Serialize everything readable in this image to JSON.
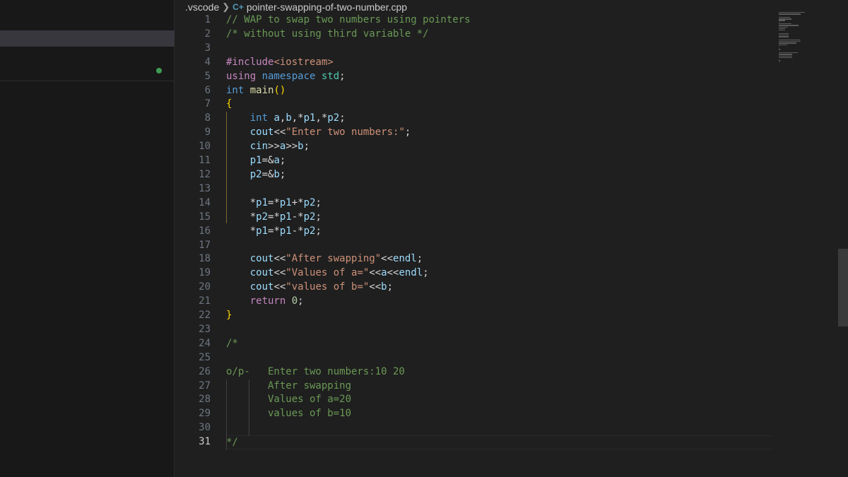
{
  "breadcrumb": {
    "folder": ".vscode",
    "file_icon": "C+",
    "file_name": "pointer-swapping-of-two-number.cpp"
  },
  "editor": {
    "active_line": 31,
    "lines": [
      [
        {
          "t": "// WAP to swap two numbers using pointers",
          "c": "cm"
        }
      ],
      [
        {
          "t": "/* without using third variable */",
          "c": "cm"
        }
      ],
      [],
      [
        {
          "t": "#include",
          "c": "pp"
        },
        {
          "t": "<iostream>",
          "c": "inc"
        }
      ],
      [
        {
          "t": "using ",
          "c": "pp"
        },
        {
          "t": "namespace ",
          "c": "kw"
        },
        {
          "t": "std",
          "c": "ns"
        },
        {
          "t": ";",
          "c": "op"
        }
      ],
      [
        {
          "t": "int ",
          "c": "ty"
        },
        {
          "t": "main",
          "c": "fn"
        },
        {
          "t": "()",
          "c": "b1"
        }
      ],
      [
        {
          "t": "{",
          "c": "b1"
        }
      ],
      [
        {
          "t": "    "
        },
        {
          "t": "int ",
          "c": "ty"
        },
        {
          "t": "a",
          "c": "var"
        },
        {
          "t": ",",
          "c": "op"
        },
        {
          "t": "b",
          "c": "var"
        },
        {
          "t": ",*",
          "c": "op"
        },
        {
          "t": "p1",
          "c": "var"
        },
        {
          "t": ",*",
          "c": "op"
        },
        {
          "t": "p2",
          "c": "var"
        },
        {
          "t": ";",
          "c": "op"
        }
      ],
      [
        {
          "t": "    "
        },
        {
          "t": "cout",
          "c": "var"
        },
        {
          "t": "<<",
          "c": "op"
        },
        {
          "t": "\"Enter two numbers:\"",
          "c": "str"
        },
        {
          "t": ";",
          "c": "op"
        }
      ],
      [
        {
          "t": "    "
        },
        {
          "t": "cin",
          "c": "var"
        },
        {
          "t": ">>",
          "c": "op"
        },
        {
          "t": "a",
          "c": "var"
        },
        {
          "t": ">>",
          "c": "op"
        },
        {
          "t": "b",
          "c": "var"
        },
        {
          "t": ";",
          "c": "op"
        }
      ],
      [
        {
          "t": "    "
        },
        {
          "t": "p1",
          "c": "var"
        },
        {
          "t": "=&",
          "c": "op"
        },
        {
          "t": "a",
          "c": "var"
        },
        {
          "t": ";",
          "c": "op"
        }
      ],
      [
        {
          "t": "    "
        },
        {
          "t": "p2",
          "c": "var"
        },
        {
          "t": "=&",
          "c": "op"
        },
        {
          "t": "b",
          "c": "var"
        },
        {
          "t": ";",
          "c": "op"
        }
      ],
      [],
      [
        {
          "t": "    "
        },
        {
          "t": "*",
          "c": "op"
        },
        {
          "t": "p1",
          "c": "var"
        },
        {
          "t": "=*",
          "c": "op"
        },
        {
          "t": "p1",
          "c": "var"
        },
        {
          "t": "+*",
          "c": "op"
        },
        {
          "t": "p2",
          "c": "var"
        },
        {
          "t": ";",
          "c": "op"
        }
      ],
      [
        {
          "t": "    "
        },
        {
          "t": "*",
          "c": "op"
        },
        {
          "t": "p2",
          "c": "var"
        },
        {
          "t": "=*",
          "c": "op"
        },
        {
          "t": "p1",
          "c": "var"
        },
        {
          "t": "-*",
          "c": "op"
        },
        {
          "t": "p2",
          "c": "var"
        },
        {
          "t": ";",
          "c": "op"
        }
      ],
      [
        {
          "t": "    "
        },
        {
          "t": "*",
          "c": "op"
        },
        {
          "t": "p1",
          "c": "var"
        },
        {
          "t": "=*",
          "c": "op"
        },
        {
          "t": "p1",
          "c": "var"
        },
        {
          "t": "-*",
          "c": "op"
        },
        {
          "t": "p2",
          "c": "var"
        },
        {
          "t": ";",
          "c": "op"
        }
      ],
      [],
      [
        {
          "t": "    "
        },
        {
          "t": "cout",
          "c": "var"
        },
        {
          "t": "<<",
          "c": "op"
        },
        {
          "t": "\"After swapping\"",
          "c": "str"
        },
        {
          "t": "<<",
          "c": "op"
        },
        {
          "t": "endl",
          "c": "var"
        },
        {
          "t": ";",
          "c": "op"
        }
      ],
      [
        {
          "t": "    "
        },
        {
          "t": "cout",
          "c": "var"
        },
        {
          "t": "<<",
          "c": "op"
        },
        {
          "t": "\"Values of a=\"",
          "c": "str"
        },
        {
          "t": "<<",
          "c": "op"
        },
        {
          "t": "a",
          "c": "var"
        },
        {
          "t": "<<",
          "c": "op"
        },
        {
          "t": "endl",
          "c": "var"
        },
        {
          "t": ";",
          "c": "op"
        }
      ],
      [
        {
          "t": "    "
        },
        {
          "t": "cout",
          "c": "var"
        },
        {
          "t": "<<",
          "c": "op"
        },
        {
          "t": "\"values of b=\"",
          "c": "str"
        },
        {
          "t": "<<",
          "c": "op"
        },
        {
          "t": "b",
          "c": "var"
        },
        {
          "t": ";",
          "c": "op"
        }
      ],
      [
        {
          "t": "    "
        },
        {
          "t": "return ",
          "c": "ret"
        },
        {
          "t": "0",
          "c": "num"
        },
        {
          "t": ";",
          "c": "op"
        }
      ],
      [
        {
          "t": "}",
          "c": "b1"
        }
      ],
      [],
      [
        {
          "t": "/*",
          "c": "cm"
        }
      ],
      [],
      [
        {
          "t": "o/p-   Enter two numbers:10 20",
          "c": "cm"
        }
      ],
      [
        {
          "t": "       After swapping",
          "c": "cm"
        }
      ],
      [
        {
          "t": "       Values of a=20",
          "c": "cm"
        }
      ],
      [
        {
          "t": "       values of b=10",
          "c": "cm"
        }
      ],
      [],
      [
        {
          "t": "*/",
          "c": "cm"
        }
      ]
    ]
  }
}
